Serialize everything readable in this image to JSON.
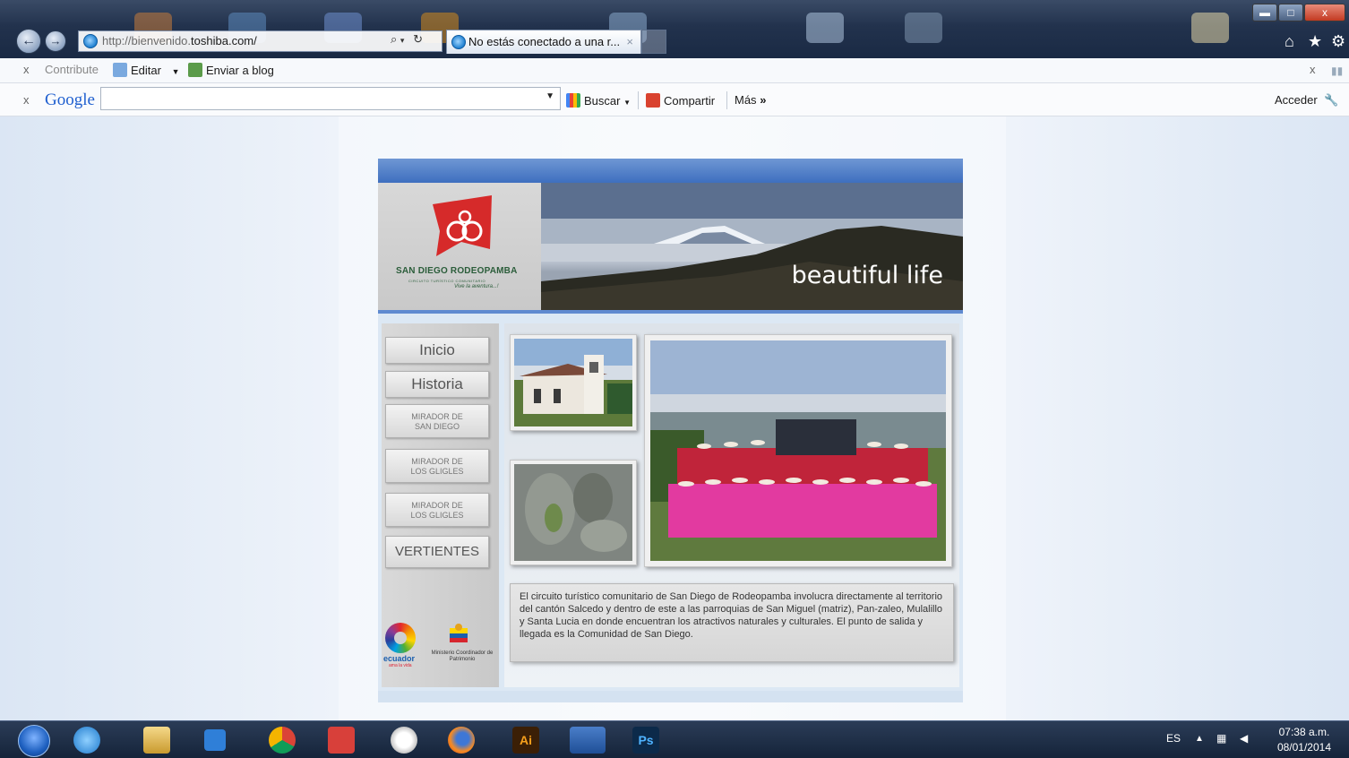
{
  "browser": {
    "address_prefix": "http://bienvenido.",
    "address_domain": "toshiba.com/",
    "tab_title": "No estás conectado a una r...",
    "tab_close": "×",
    "window_min": "▬",
    "window_max": "□",
    "window_close": "x"
  },
  "toolbar1": {
    "close": "x",
    "contribute": "Contribute",
    "edit": "Editar",
    "send_blog": "Enviar a blog",
    "right_close": "x"
  },
  "toolbar2": {
    "close": "x",
    "google": "Google",
    "search_value": "",
    "search_button": "Buscar",
    "share": "Compartir",
    "more": "Más",
    "login": "Acceder"
  },
  "site": {
    "logo_name": "SAN DIEGO RODEOPAMBA",
    "logo_subtitle": "CIRCUITO TURÍSTICO COMUNITARIO",
    "logo_tagline": "Vive la aventura...!",
    "banner_text": "beautiful life",
    "nav": [
      {
        "label": "Inicio"
      },
      {
        "label": "Historia"
      },
      {
        "line1": "MIRADOR DE",
        "line2": "SAN DIEGO"
      },
      {
        "line1": "MIRADOR DE",
        "line2": "LOS GLIGLES"
      },
      {
        "line1": "MIRADOR DE",
        "line2": "LOS GLIGLES"
      },
      {
        "label": "VERTIENTES"
      }
    ],
    "description": "El circuito turístico comunitario de San Diego de Rodeopamba involucra directamente al territorio del cantón Salcedo y dentro de este a las parroquias de San Miguel (matriz), Pan-zaleo, Mulalillo y Santa Lucia en donde encuentran los atractivos naturales y culturales. El punto de salida y llegada es la Comunidad de San Diego.",
    "logo_ecuador": "ecuador",
    "logo_ecuador_sub": "ama la vida",
    "logo_ministry": "Ministerio Coordinador de Patrimonio"
  },
  "taskbar": {
    "lang": "ES",
    "time": "07:38 a.m.",
    "date": "08/01/2014",
    "apps": [
      "ie-icon",
      "explorer-icon",
      "media-icon",
      "chrome-icon",
      "todoist-icon",
      "clock-icon",
      "firefox-icon",
      "illustrator-icon",
      "word-icon",
      "photoshop-icon"
    ],
    "illustrator_label": "Ai",
    "photoshop_label": "Ps"
  },
  "colors": {
    "banner_blue": "#3e6fbf",
    "logo_red": "#d62a2a",
    "taskbar": "#1a2a44"
  }
}
